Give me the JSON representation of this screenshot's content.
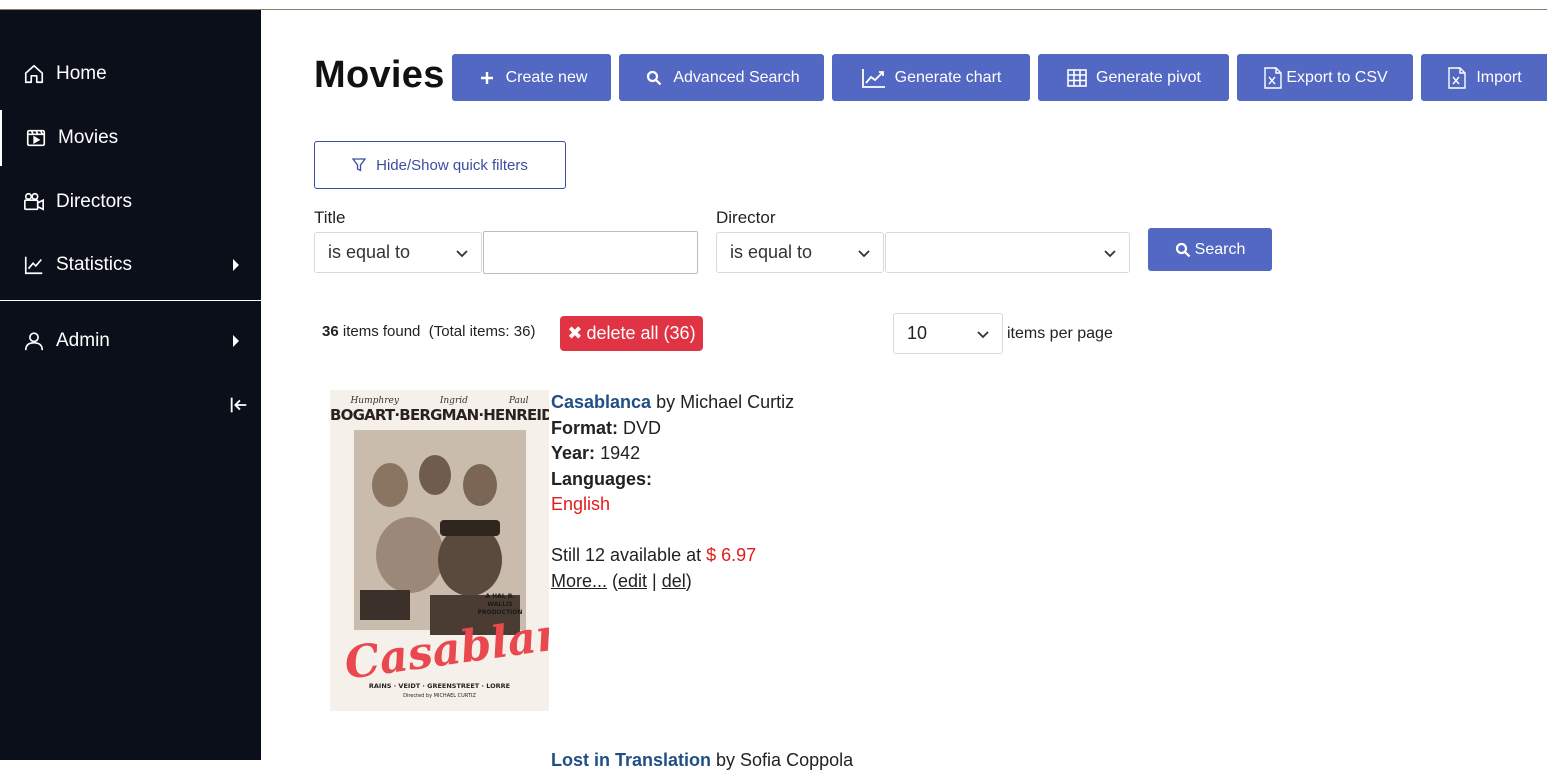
{
  "sidebar": {
    "items": [
      {
        "label": "Home",
        "icon": "home-icon"
      },
      {
        "label": "Movies",
        "icon": "film-icon"
      },
      {
        "label": "Directors",
        "icon": "video-camera-icon"
      },
      {
        "label": "Statistics",
        "icon": "chart-line-icon"
      },
      {
        "label": "Admin",
        "icon": "user-icon"
      }
    ],
    "collapse_icon": "collapse-left-icon"
  },
  "header": {
    "title": "Movies",
    "buttons": {
      "create_new": "Create new",
      "advanced_search": "Advanced Search",
      "generate_chart": "Generate chart",
      "generate_pivot": "Generate pivot",
      "export_csv": "Export to CSV",
      "import": "Import"
    }
  },
  "filters": {
    "toggle_label": "Hide/Show quick filters",
    "title_label": "Title",
    "title_operator": "is equal to",
    "title_value": "",
    "director_label": "Director",
    "director_operator": "is equal to",
    "director_value": "",
    "search_label": "Search"
  },
  "results": {
    "count": "36",
    "found_text": "items found",
    "total_text": "(Total items: 36)",
    "delete_all_label": "delete all (36)",
    "per_page_value": "10",
    "per_page_label": "items per page"
  },
  "items": [
    {
      "title": "Casablanca",
      "by_text": "by Michael Curtiz",
      "format_label": "Format:",
      "format": "DVD",
      "year_label": "Year:",
      "year": "1942",
      "languages_label": "Languages:",
      "language": "English",
      "availability_text": "Still 12 available at",
      "price": "$ 6.97",
      "more_label": "More...",
      "edit_label": "edit",
      "del_label": "del",
      "poster": {
        "names": [
          "Humphrey",
          "Ingrid",
          "Paul"
        ],
        "stars": "BOGART·BERGMAN·HENREID",
        "title_text": "Casablanca",
        "production": "A HAL B. WALLIS PRODUCTION",
        "cast": "RAINS · VEIDT · GREENSTREET · LORRE",
        "director_credit": "Directed by MICHAEL CURTIZ"
      }
    },
    {
      "title": "Lost in Translation",
      "by_text": "by Sofia Coppola"
    }
  ],
  "colors": {
    "sidebar_bg": "#0b0f1a",
    "primary": "#5268c2",
    "danger": "#e03444",
    "link": "#1f4f86",
    "price": "#e21b1b"
  }
}
